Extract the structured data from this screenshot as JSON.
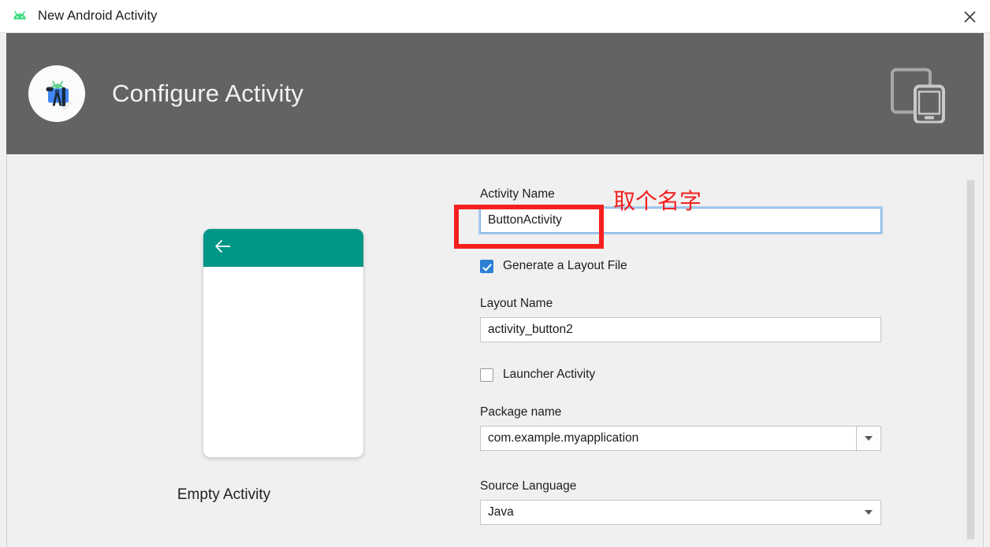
{
  "window": {
    "title": "New Android Activity",
    "titlebar_icon": "android-icon",
    "close_icon": "close-icon"
  },
  "header": {
    "title": "Configure Activity",
    "logo_icon": "android-studio-logo-icon",
    "device_icon": "tablet-and-phone-icon"
  },
  "preview": {
    "template_label": "Empty Activity",
    "appbar_color": "#009688",
    "back_icon": "back-arrow-icon"
  },
  "form": {
    "activity_name": {
      "label": "Activity Name",
      "value": "ButtonActivity",
      "placeholder": ""
    },
    "generate_layout": {
      "label": "Generate a Layout File",
      "checked": true
    },
    "layout_name": {
      "label": "Layout Name",
      "value": "activity_button2",
      "placeholder": ""
    },
    "launcher_activity": {
      "label": "Launcher Activity",
      "checked": false
    },
    "package_name": {
      "label": "Package name",
      "value": "com.example.myapplication",
      "dropdown_icon": "chevron-down-icon"
    },
    "source_language": {
      "label": "Source Language",
      "value": "Java",
      "dropdown_icon": "chevron-down-icon"
    }
  },
  "annotation": {
    "text": "取个名字",
    "color": "#f5201e"
  }
}
